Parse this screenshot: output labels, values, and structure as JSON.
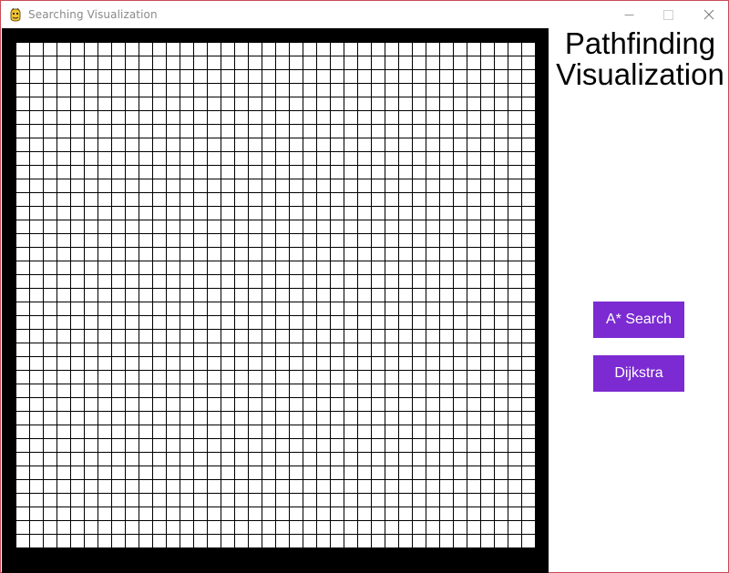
{
  "window": {
    "title": "Searching Visualization",
    "icon": "pygame-snake-icon",
    "controls": [
      "minimize-icon",
      "maximize-icon",
      "close-icon"
    ]
  },
  "grid": {
    "rows": 38,
    "cols": 38,
    "cell_color": "#ffffff",
    "line_color": "#000000",
    "border_color": "#000000"
  },
  "sidebar": {
    "title_line1": "Pathfinding",
    "title_line2": "Visualization",
    "buttons": [
      {
        "label": "A* Search"
      },
      {
        "label": "Dijkstra"
      }
    ],
    "button_color": "#7b2bd1"
  }
}
